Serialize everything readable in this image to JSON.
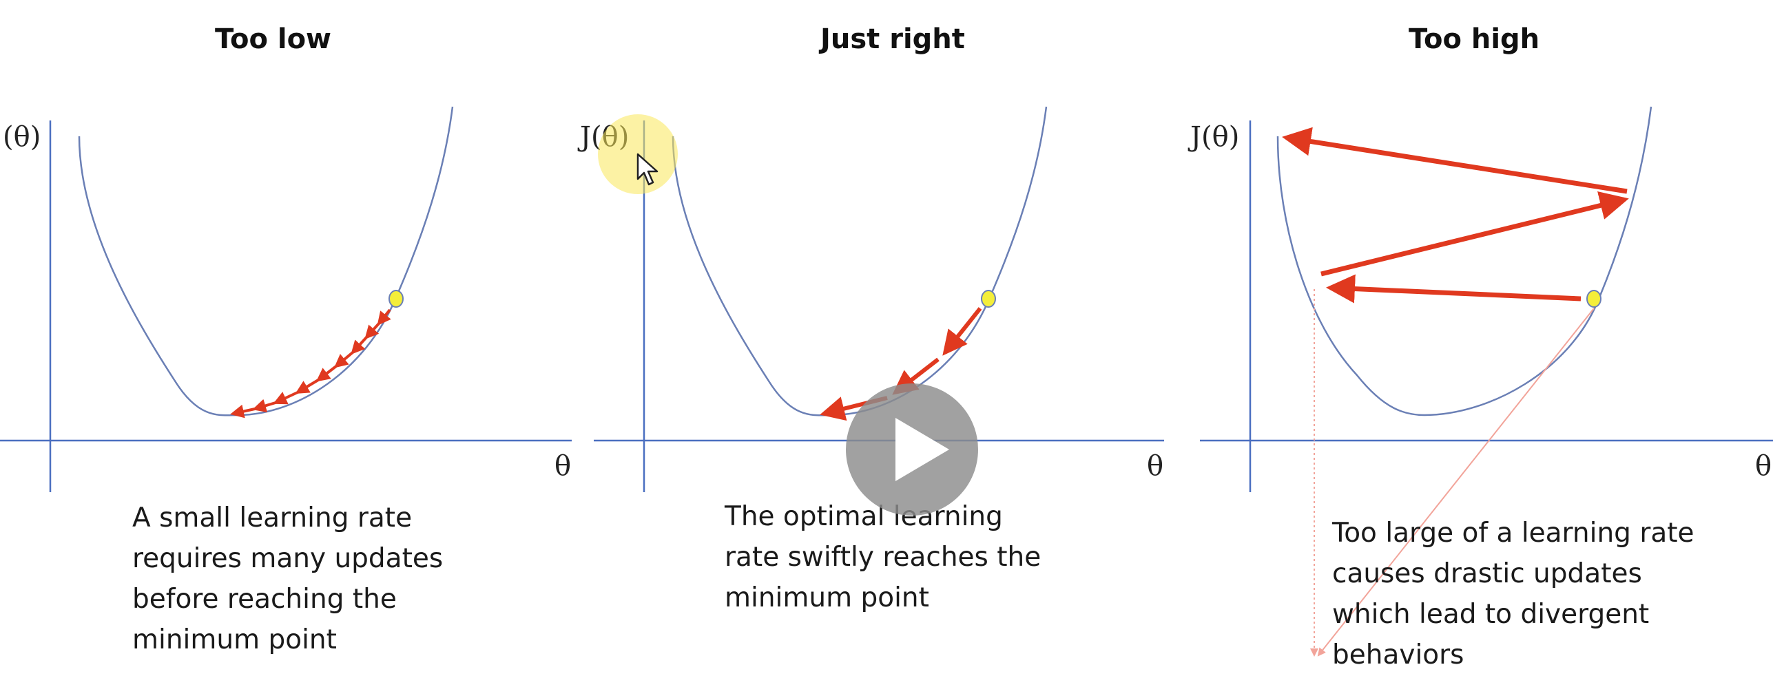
{
  "panels": [
    {
      "title": "Too low",
      "ylabel": "(θ)",
      "xlabel": "θ",
      "caption": [
        "A small learning rate",
        "requires many updates",
        "before reaching the",
        "minimum point"
      ]
    },
    {
      "title": "Just right",
      "ylabel": "J(θ)",
      "xlabel": "θ",
      "caption": [
        "The optimal learning",
        "rate swiftly reaches the",
        "minimum point"
      ]
    },
    {
      "title": "Too high",
      "ylabel": "J(θ)",
      "xlabel": "θ",
      "caption": [
        "Too large of a learning rate",
        "causes drastic updates",
        "which lead to divergent",
        "behaviors"
      ]
    }
  ],
  "colors": {
    "curve": "#6a7fb5",
    "axis": "#4a6fc0",
    "arrow": "#e0391f",
    "point_fill": "#f4ee3a",
    "point_stroke": "#6a7fb5"
  },
  "overlay": {
    "play_icon": "play-icon",
    "cursor_icon": "mouse-pointer-icon"
  }
}
